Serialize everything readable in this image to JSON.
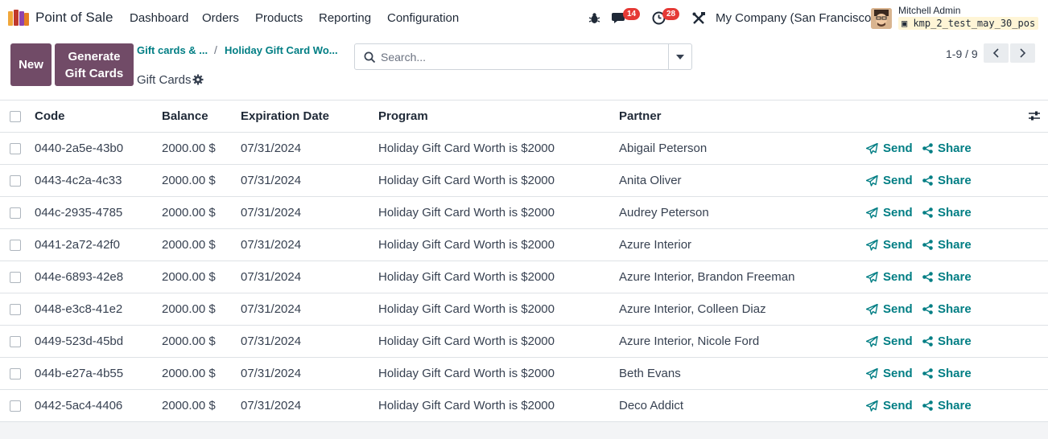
{
  "nav": {
    "app_name": "Point of Sale",
    "menus": [
      "Dashboard",
      "Orders",
      "Products",
      "Reporting",
      "Configuration"
    ],
    "messages_count": "14",
    "activities_count": "28",
    "company": "My Company (San Francisco)",
    "user_name": "Mitchell Admin",
    "database": "kmp_2_test_may_30_pos"
  },
  "control": {
    "new_label": "New",
    "generate_label": "Generate Gift Cards",
    "breadcrumb_1": "Gift cards & ...",
    "breadcrumb_sep": "/",
    "breadcrumb_2": "Holiday Gift Card Wo...",
    "current_title": "Gift Cards",
    "search_placeholder": "Search...",
    "pager": "1-9 / 9"
  },
  "table": {
    "columns": [
      "Code",
      "Balance",
      "Expiration Date",
      "Program",
      "Partner"
    ],
    "send_label": "Send",
    "share_label": "Share",
    "rows": [
      {
        "code": "0440-2a5e-43b0",
        "balance": "2000.00 $",
        "expiration": "07/31/2024",
        "program": "Holiday Gift Card Worth is $2000",
        "partner": "Abigail Peterson"
      },
      {
        "code": "0443-4c2a-4c33",
        "balance": "2000.00 $",
        "expiration": "07/31/2024",
        "program": "Holiday Gift Card Worth is $2000",
        "partner": "Anita Oliver"
      },
      {
        "code": "044c-2935-4785",
        "balance": "2000.00 $",
        "expiration": "07/31/2024",
        "program": "Holiday Gift Card Worth is $2000",
        "partner": "Audrey Peterson"
      },
      {
        "code": "0441-2a72-42f0",
        "balance": "2000.00 $",
        "expiration": "07/31/2024",
        "program": "Holiday Gift Card Worth is $2000",
        "partner": "Azure Interior"
      },
      {
        "code": "044e-6893-42e8",
        "balance": "2000.00 $",
        "expiration": "07/31/2024",
        "program": "Holiday Gift Card Worth is $2000",
        "partner": "Azure Interior, Brandon Freeman"
      },
      {
        "code": "0448-e3c8-41e2",
        "balance": "2000.00 $",
        "expiration": "07/31/2024",
        "program": "Holiday Gift Card Worth is $2000",
        "partner": "Azure Interior, Colleen Diaz"
      },
      {
        "code": "0449-523d-45bd",
        "balance": "2000.00 $",
        "expiration": "07/31/2024",
        "program": "Holiday Gift Card Worth is $2000",
        "partner": "Azure Interior, Nicole Ford"
      },
      {
        "code": "044b-e27a-4b55",
        "balance": "2000.00 $",
        "expiration": "07/31/2024",
        "program": "Holiday Gift Card Worth is $2000",
        "partner": "Beth Evans"
      },
      {
        "code": "0442-5ac4-4406",
        "balance": "2000.00 $",
        "expiration": "07/31/2024",
        "program": "Holiday Gift Card Worth is $2000",
        "partner": "Deco Addict"
      }
    ]
  },
  "icons": {
    "app_logo": "pos-logo-icon",
    "debug": "bug-icon",
    "messages": "chat-icon",
    "activities": "clock-icon",
    "tools": "tools-icon",
    "settings": "gear-icon",
    "search": "search-icon",
    "dropdown": "caret-down-icon",
    "prev": "chevron-left-icon",
    "next": "chevron-right-icon",
    "send": "paper-plane-icon",
    "share": "share-icon",
    "optional_columns": "sliders-icon"
  },
  "colors": {
    "primary": "#714b67",
    "link": "#017e84",
    "badge": "#e53935"
  }
}
